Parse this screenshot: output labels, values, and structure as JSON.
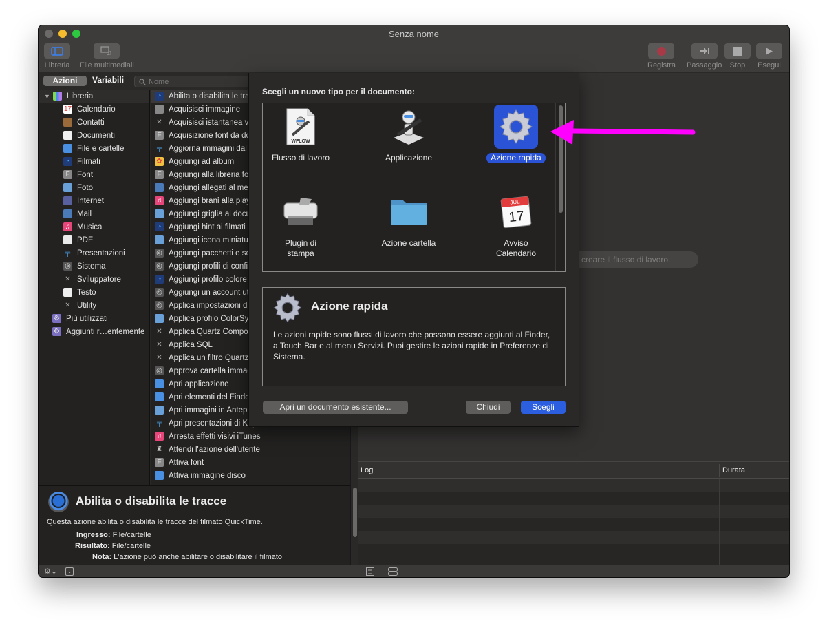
{
  "window": {
    "title": "Senza nome"
  },
  "toolbar": {
    "left": [
      {
        "label": "Libreria",
        "icon": "library-icon"
      },
      {
        "label": "File multimediali",
        "icon": "media-icon"
      }
    ],
    "right": [
      {
        "label": "Registra",
        "icon": "record-icon"
      },
      {
        "label": "Passaggio",
        "icon": "step-icon"
      },
      {
        "label": "Stop",
        "icon": "stop-icon"
      },
      {
        "label": "Esegui",
        "icon": "play-icon"
      }
    ]
  },
  "library_tabs": {
    "actions": "Azioni",
    "variables": "Variabili",
    "search_placeholder": "Nome",
    "search_value": ""
  },
  "library": {
    "root": "Libreria",
    "children": [
      {
        "label": "Calendario",
        "icon": "calendar-icon"
      },
      {
        "label": "Contatti",
        "icon": "contacts-icon"
      },
      {
        "label": "Documenti",
        "icon": "document-icon"
      },
      {
        "label": "File e cartelle",
        "icon": "finder-icon"
      },
      {
        "label": "Filmati",
        "icon": "quicktime-icon"
      },
      {
        "label": "Font",
        "icon": "font-icon"
      },
      {
        "label": "Foto",
        "icon": "photo-icon"
      },
      {
        "label": "Internet",
        "icon": "globe-icon"
      },
      {
        "label": "Mail",
        "icon": "mail-icon"
      },
      {
        "label": "Musica",
        "icon": "music-icon"
      },
      {
        "label": "PDF",
        "icon": "pdf-icon"
      },
      {
        "label": "Presentazioni",
        "icon": "keynote-icon"
      },
      {
        "label": "Sistema",
        "icon": "system-icon"
      },
      {
        "label": "Sviluppatore",
        "icon": "developer-icon"
      },
      {
        "label": "Testo",
        "icon": "text-icon"
      },
      {
        "label": "Utility",
        "icon": "utility-icon"
      }
    ],
    "groups": [
      {
        "label": "Più utilizzati",
        "icon": "smart-folder-icon"
      },
      {
        "label": "Aggiunti r…entemente",
        "icon": "smart-folder-icon"
      }
    ]
  },
  "actions": [
    {
      "label": "Abilita o disabilita le tracce",
      "icon": "quicktime-icon",
      "selected": true
    },
    {
      "label": "Acquisisci immagine",
      "icon": "camera-icon"
    },
    {
      "label": "Acquisisci istantanea video",
      "icon": "developer-icon"
    },
    {
      "label": "Acquisizione font da documento",
      "icon": "font-icon"
    },
    {
      "label": "Aggiorna immagini dal",
      "icon": "keynote-icon"
    },
    {
      "label": "Aggiungi ad album",
      "icon": "photos-icon"
    },
    {
      "label": "Aggiungi alla libreria font",
      "icon": "font-icon"
    },
    {
      "label": "Aggiungi allegati al messaggio",
      "icon": "mail-icon"
    },
    {
      "label": "Aggiungi brani alla playlist",
      "icon": "music-icon"
    },
    {
      "label": "Aggiungi griglia ai documenti",
      "icon": "photo-icon"
    },
    {
      "label": "Aggiungi hint ai filmati",
      "icon": "quicktime-icon"
    },
    {
      "label": "Aggiungi icona miniatura",
      "icon": "photo-icon"
    },
    {
      "label": "Aggiungi pacchetti e script",
      "icon": "system-icon"
    },
    {
      "label": "Aggiungi profili di configurazione",
      "icon": "system-icon"
    },
    {
      "label": "Aggiungi profilo colore",
      "icon": "quicktime-icon"
    },
    {
      "label": "Aggiungi un account utente",
      "icon": "system-icon"
    },
    {
      "label": "Applica impostazioni di",
      "icon": "system-icon"
    },
    {
      "label": "Applica profilo ColorSync",
      "icon": "photo-icon"
    },
    {
      "label": "Applica Quartz Composition",
      "icon": "developer-icon"
    },
    {
      "label": "Applica SQL",
      "icon": "developer-icon"
    },
    {
      "label": "Applica un filtro Quartz",
      "icon": "developer-icon"
    },
    {
      "label": "Approva cartella immagini",
      "icon": "system-icon"
    },
    {
      "label": "Apri applicazione",
      "icon": "finder-icon"
    },
    {
      "label": "Apri elementi del Finder",
      "icon": "finder-icon"
    },
    {
      "label": "Apri immagini in Anteprima",
      "icon": "photo-icon"
    },
    {
      "label": "Apri presentazioni di Keynote",
      "icon": "keynote-icon"
    },
    {
      "label": "Arresta effetti visivi iTunes",
      "icon": "music-icon"
    },
    {
      "label": "Attendi l'azione dell'utente",
      "icon": "automator-icon"
    },
    {
      "label": "Attiva font",
      "icon": "font-icon"
    },
    {
      "label": "Attiva immagine disco",
      "icon": "finder-icon"
    }
  ],
  "description": {
    "title": "Abilita o disabilita le tracce",
    "summary": "Questa azione abilita o disabilita le tracce del filmato QuickTime.",
    "input_label": "Ingresso:",
    "input_value": "File/cartelle",
    "result_label": "Risultato:",
    "result_value": "File/cartelle",
    "note_label": "Nota:",
    "note_value": "L'azione può anche abilitare o disabilitare il filmato"
  },
  "workspace": {
    "hint": "er creare il flusso di lavoro."
  },
  "log": {
    "columns": [
      "Log",
      "Durata"
    ],
    "rows": []
  },
  "dialog": {
    "prompt": "Scegli un nuovo tipo per il documento:",
    "types": [
      {
        "label": "Flusso di lavoro",
        "icon": "workflow-file-icon",
        "badge": "WFLOW",
        "selected": false
      },
      {
        "label": "Applicazione",
        "icon": "automator-robot-icon",
        "selected": false
      },
      {
        "label": "Azione rapida",
        "icon": "gear-icon",
        "selected": true
      },
      {
        "label": "Plugin di stampa",
        "icon": "printer-icon",
        "selected": false
      },
      {
        "label": "Azione cartella",
        "icon": "folder-icon",
        "selected": false
      },
      {
        "label": "Avviso Calendario",
        "icon": "calendar-icon",
        "calendar_month": "JUL",
        "calendar_day": "17",
        "selected": false
      }
    ],
    "info_title": "Azione rapida",
    "info_text": "Le azioni rapide sono flussi di lavoro che possono essere aggiunti al Finder, a Touch Bar e al menu Servizi. Puoi gestire le azioni rapide in Preferenze di Sistema.",
    "buttons": {
      "open_existing": "Apri un documento esistente...",
      "close": "Chiudi",
      "choose": "Scegli"
    }
  },
  "colors": {
    "accent": "#2c5fe0",
    "annotation_arrow": "#ff00ff"
  }
}
